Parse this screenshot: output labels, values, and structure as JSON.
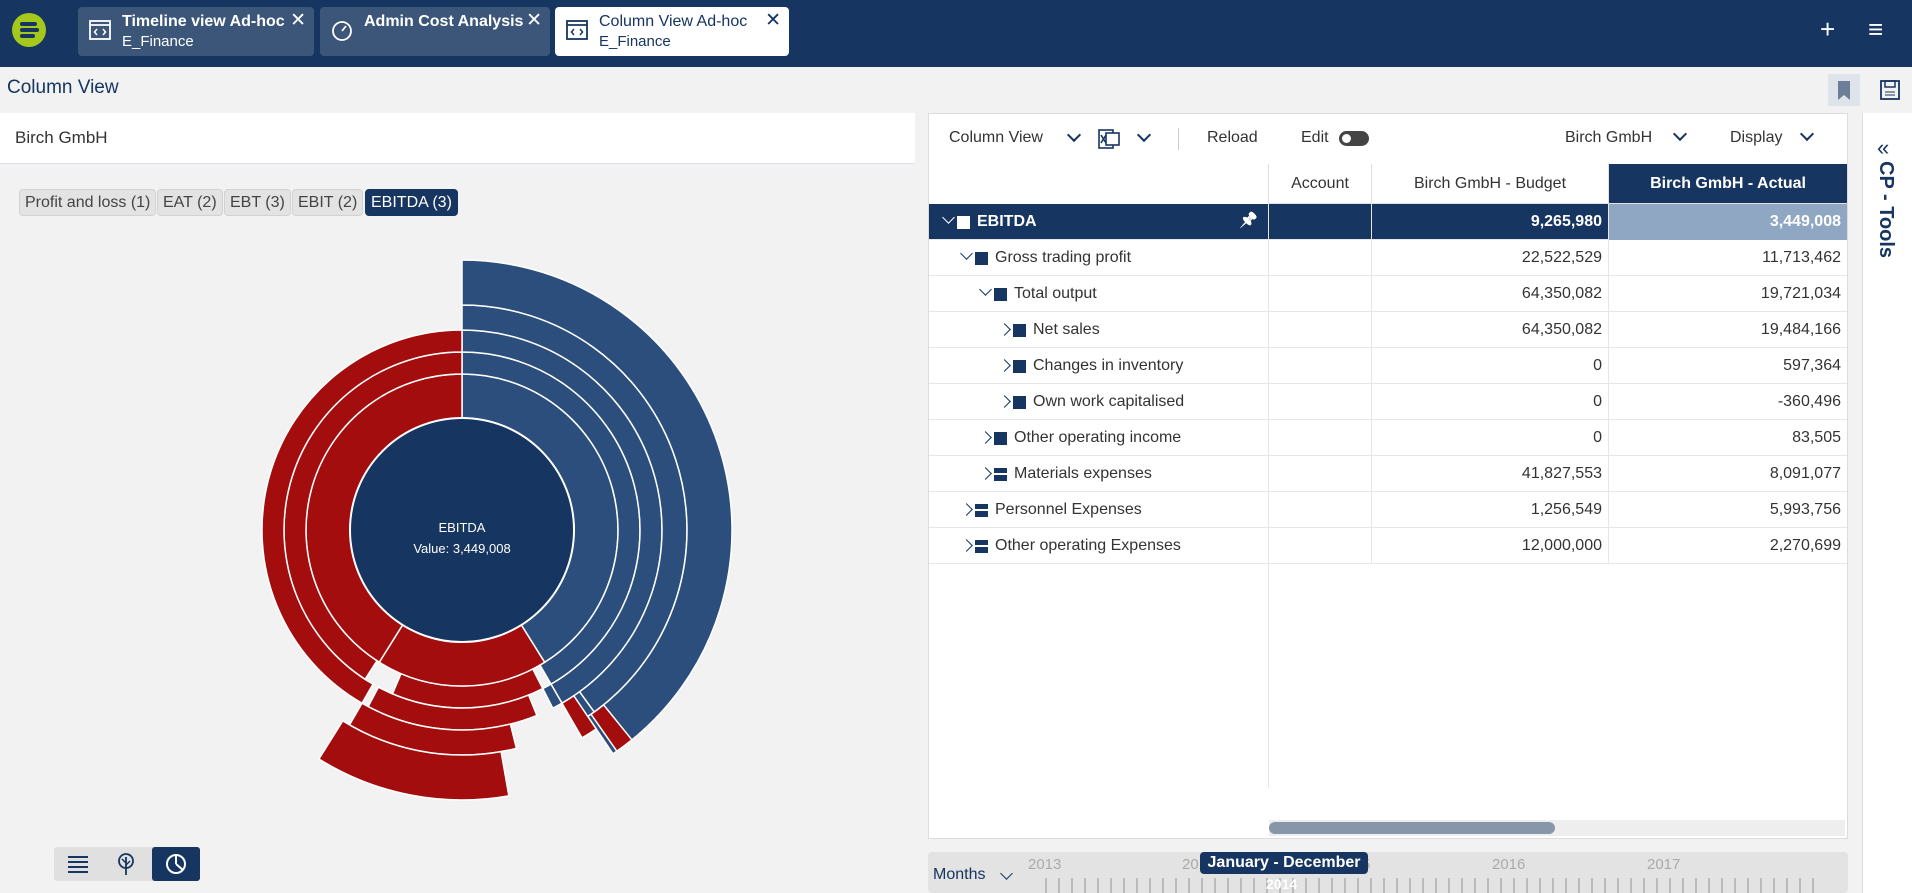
{
  "app": {
    "colors": {
      "navy": "#163560",
      "red": "#a30d0d",
      "blue": "#2b4e7c",
      "accent": "#a4c81c"
    },
    "tabs": [
      {
        "title": "Timeline view Ad-hoc",
        "sub": "E_Finance",
        "icon": "code-window-icon"
      },
      {
        "title": "Admin Cost Analysis",
        "sub": "",
        "icon": "gauge-icon"
      },
      {
        "title": "Column View Ad-hoc",
        "sub": "E_Finance",
        "icon": "code-window-icon"
      }
    ]
  },
  "page": {
    "title": "Column View",
    "company": "Birch GmbH",
    "pills": [
      "Profit and loss (1)",
      "EAT (2)",
      "EBT (3)",
      "EBIT (2)",
      "EBITDA (3)"
    ],
    "sunburst": {
      "center_label": "EBITDA",
      "center_value": "Value: 3,449,008"
    }
  },
  "toolbar": {
    "view": "Column View",
    "reload": "Reload",
    "edit": "Edit",
    "company": "Birch GmbH",
    "display": "Display"
  },
  "grid": {
    "headers": [
      "Account",
      "Birch GmbH - Budget",
      "Birch GmbH - Actual"
    ],
    "rows": [
      {
        "label": "EBITDA",
        "budget": "9,265,980",
        "actual": "3,449,008"
      },
      {
        "label": "Gross trading profit",
        "budget": "22,522,529",
        "actual": "11,713,462"
      },
      {
        "label": "Total output",
        "budget": "64,350,082",
        "actual": "19,721,034"
      },
      {
        "label": "Net sales",
        "budget": "64,350,082",
        "actual": "19,484,166"
      },
      {
        "label": "Changes in inventory",
        "budget": "0",
        "actual": "597,364"
      },
      {
        "label": "Own work capitalised",
        "budget": "0",
        "actual": "-360,496"
      },
      {
        "label": "Other operating income",
        "budget": "0",
        "actual": "83,505"
      },
      {
        "label": "Materials expenses",
        "budget": "41,827,553",
        "actual": "8,091,077"
      },
      {
        "label": "Personnel Expenses",
        "budget": "1,256,549",
        "actual": "5,993,756"
      },
      {
        "label": "Other operating Expenses",
        "budget": "12,000,000",
        "actual": "2,270,699"
      }
    ]
  },
  "timeline": {
    "granularity": "Months",
    "range_label": "January - December",
    "selected_year": "2014",
    "years": [
      "2013",
      "2014",
      "2015",
      "2016",
      "2017"
    ]
  },
  "sidebar": {
    "label": "CP - Tools"
  }
}
